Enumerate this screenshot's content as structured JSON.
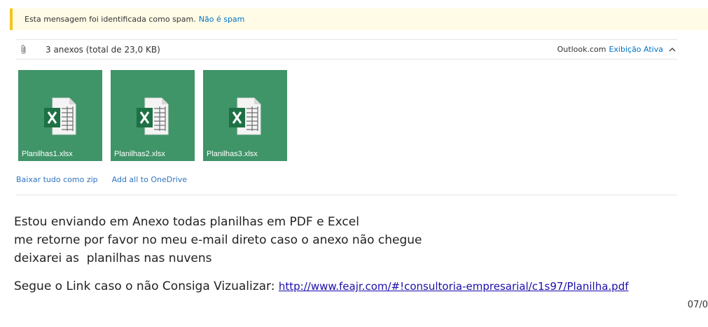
{
  "spam_notice": {
    "message": "Esta mensagem foi identificada como spam.",
    "not_spam_link": "Não é spam"
  },
  "attachments_header": {
    "count_label": "3 anexos (total de 23,0 KB)",
    "brand": "Outlook.com",
    "view_link": "Exibição Ativa",
    "icons": {
      "attachment": "paperclip-icon",
      "collapse": "chevron-up-icon"
    }
  },
  "attachments": [
    {
      "name": "Planilhas1.xlsx",
      "icon": "excel-file-icon"
    },
    {
      "name": "Planilhas2.xlsx",
      "icon": "excel-file-icon"
    },
    {
      "name": "Planilhas3.xlsx",
      "icon": "excel-file-icon"
    }
  ],
  "attachment_actions": {
    "download_zip": "Baixar tudo como zip",
    "add_onedrive": "Add all to OneDrive"
  },
  "body": {
    "line1": "Estou enviando em Anexo todas planilhas em PDF e Excel",
    "line2": "me retorne por favor no meu e-mail direto caso o anexo não chegue",
    "line3": "deixarei as  planilhas nas nuvens",
    "link_prefix": "Segue o Link caso o não Consiga Vizualizar: ",
    "link_text": "http://www.feajr.com/#!consultoria-empresarial/c1s97/Planilha.pdf"
  },
  "date_fragment": "07/0",
  "colors": {
    "tile_green": "#3f9468",
    "link_blue": "#0072c6",
    "spam_accent": "#f5c518"
  }
}
